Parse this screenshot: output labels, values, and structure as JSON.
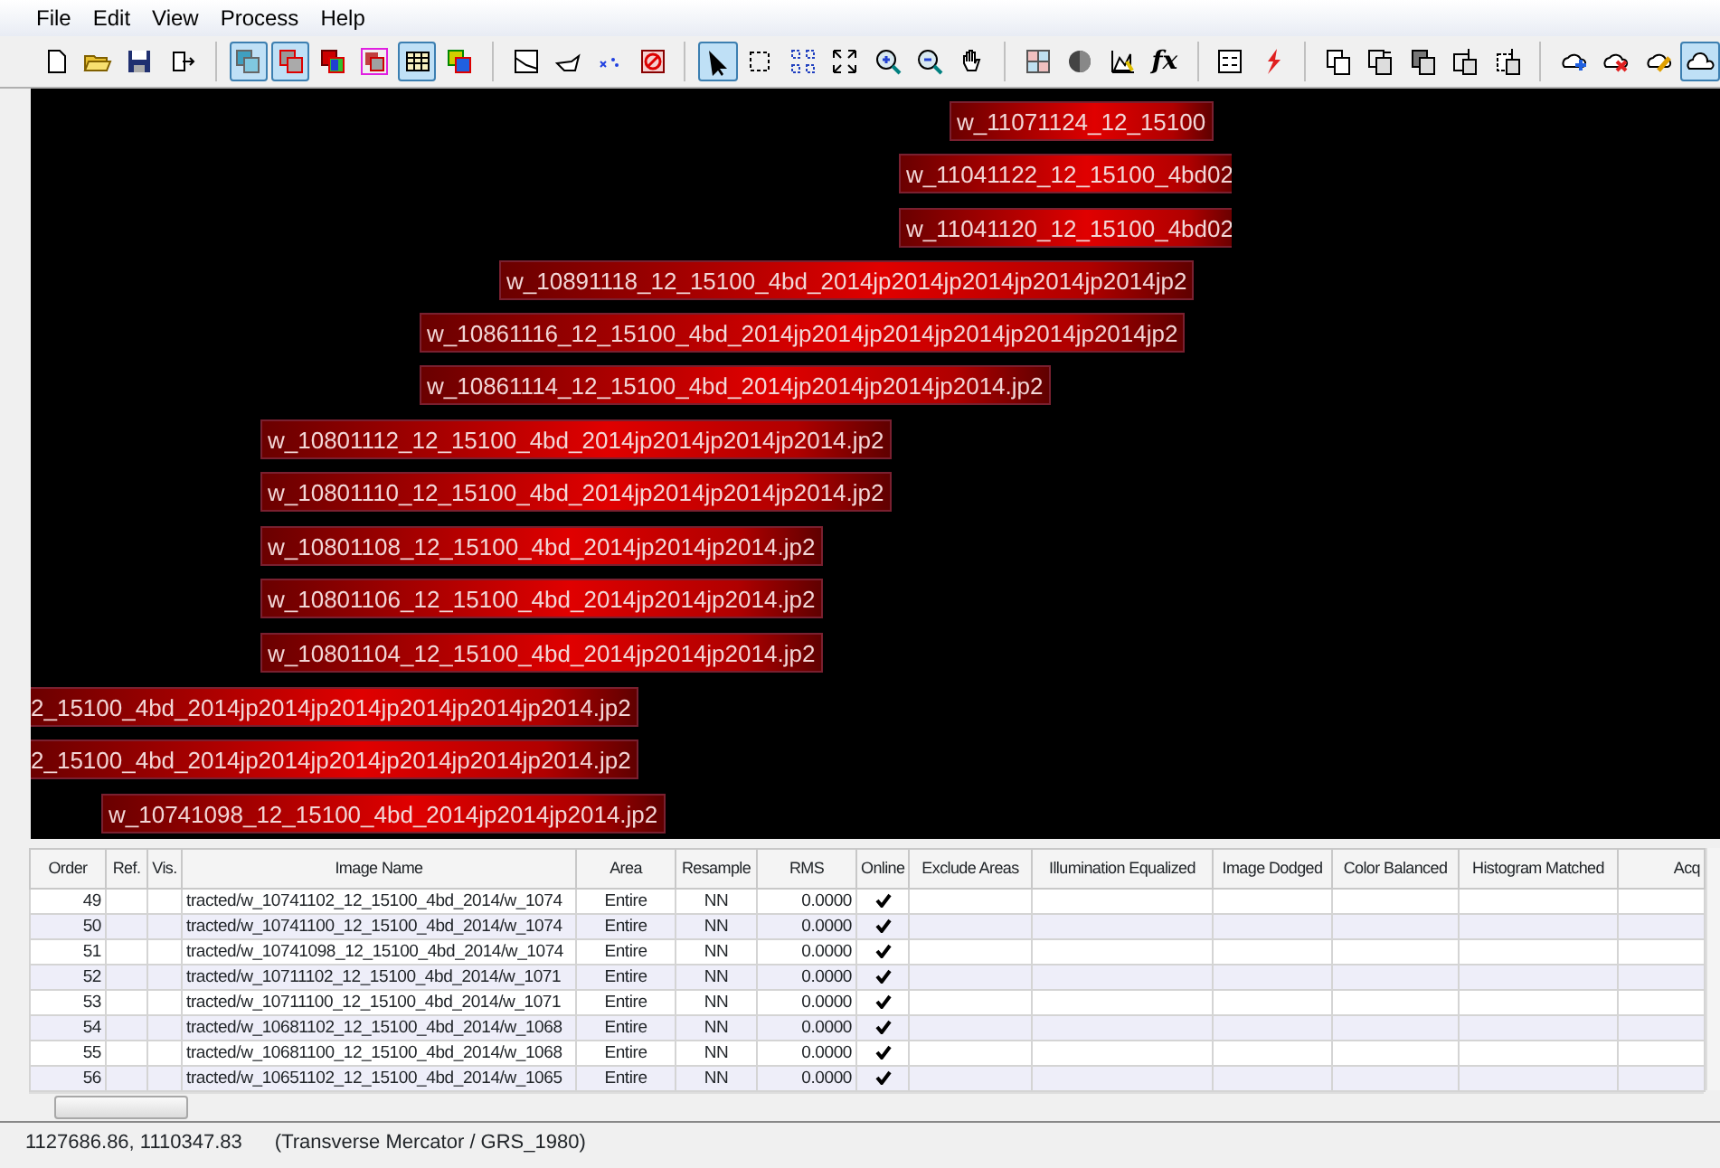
{
  "menu": [
    "File",
    "Edit",
    "View",
    "Process",
    "Help"
  ],
  "toolbar": [
    [
      {
        "kind": "new",
        "pressed": false
      },
      {
        "kind": "open",
        "pressed": false
      },
      {
        "kind": "save",
        "pressed": false
      },
      {
        "kind": "export",
        "pressed": false
      }
    ],
    [
      {
        "kind": "footprints",
        "pressed": true
      },
      {
        "kind": "boundaries",
        "pressed": true
      },
      {
        "kind": "color",
        "pressed": false
      },
      {
        "kind": "pink",
        "pressed": false
      },
      {
        "kind": "table",
        "pressed": true
      },
      {
        "kind": "balance",
        "pressed": false
      }
    ],
    [
      {
        "kind": "seamline",
        "pressed": false
      },
      {
        "kind": "edit",
        "pressed": false
      },
      {
        "kind": "points",
        "pressed": false
      },
      {
        "kind": "clear",
        "pressed": false
      }
    ],
    [
      {
        "kind": "select",
        "pressed": true
      },
      {
        "kind": "marquee",
        "pressed": false
      },
      {
        "kind": "fit",
        "pressed": false
      },
      {
        "kind": "full",
        "pressed": false
      },
      {
        "kind": "zoomin",
        "pressed": false
      },
      {
        "kind": "zoomout",
        "pressed": false
      },
      {
        "kind": "pan",
        "pressed": false
      }
    ],
    [
      {
        "kind": "tiles",
        "pressed": false
      },
      {
        "kind": "sphere",
        "pressed": false
      },
      {
        "kind": "chart",
        "pressed": false
      },
      {
        "kind": "text",
        "label": "fx",
        "pressed": false
      }
    ],
    [
      {
        "kind": "form",
        "pressed": false
      },
      {
        "kind": "bolt",
        "pressed": false
      }
    ],
    [
      {
        "kind": "copy",
        "pressed": false
      },
      {
        "kind": "copyarrow",
        "pressed": false
      },
      {
        "kind": "copydark",
        "pressed": false
      },
      {
        "kind": "copyup",
        "pressed": false
      },
      {
        "kind": "copydash",
        "pressed": false
      }
    ],
    [
      {
        "kind": "cloudadd",
        "pressed": false
      },
      {
        "kind": "clouddel",
        "pressed": false
      },
      {
        "kind": "cloudedit",
        "pressed": false
      },
      {
        "kind": "cloud",
        "pressed": true
      }
    ]
  ],
  "canvas_labels": [
    "w_11071124_12_15100",
    "w_11041122_12_15100_4bd02",
    "w_11041120_12_15100_4bd02",
    "w_10891118_12_15100_4bd_2014jp2014jp2014jp2014jp2014jp2",
    "w_10861116_12_15100_4bd_2014jp2014jp2014jp2014jp2014jp2014jp2",
    "w_10861114_12_15100_4bd_2014jp2014jp2014jp2014.jp2",
    "w_10801112_12_15100_4bd_2014jp2014jp2014jp2014.jp2",
    "w_10801110_12_15100_4bd_2014jp2014jp2014jp2014.jp2",
    "w_10801108_12_15100_4bd_2014jp2014jp2014.jp2",
    "w_10801106_12_15100_4bd_2014jp2014jp2014.jp2",
    "w_10801104_12_15100_4bd_2014jp2014jp2014.jp2",
    "2_15100_4bd_2014jp2014jp2014jp2014jp2014jp2014.jp2",
    "2_15100_4bd_2014jp2014jp2014jp2014jp2014jp2014.jp2",
    "w_10741098_12_15100_4bd_2014jp2014jp2014.jp2"
  ],
  "table": {
    "columns": [
      "Order",
      "Ref.",
      "Vis.",
      "Image Name",
      "Area",
      "Resample",
      "RMS",
      "Online",
      "Exclude Areas",
      "Illumination Equalized",
      "Image Dodged",
      "Color Balanced",
      "Histogram Matched",
      "Acq"
    ],
    "rows": [
      {
        "order": "49",
        "image_name": "tracted/w_10741102_12_15100_4bd_2014/w_1074",
        "area": "Entire",
        "resample": "NN",
        "rms": "0.0000",
        "online": true
      },
      {
        "order": "50",
        "image_name": "tracted/w_10741100_12_15100_4bd_2014/w_1074",
        "area": "Entire",
        "resample": "NN",
        "rms": "0.0000",
        "online": true
      },
      {
        "order": "51",
        "image_name": "tracted/w_10741098_12_15100_4bd_2014/w_1074",
        "area": "Entire",
        "resample": "NN",
        "rms": "0.0000",
        "online": true
      },
      {
        "order": "52",
        "image_name": "tracted/w_10711102_12_15100_4bd_2014/w_1071",
        "area": "Entire",
        "resample": "NN",
        "rms": "0.0000",
        "online": true
      },
      {
        "order": "53",
        "image_name": "tracted/w_10711100_12_15100_4bd_2014/w_1071",
        "area": "Entire",
        "resample": "NN",
        "rms": "0.0000",
        "online": true
      },
      {
        "order": "54",
        "image_name": "tracted/w_10681102_12_15100_4bd_2014/w_1068",
        "area": "Entire",
        "resample": "NN",
        "rms": "0.0000",
        "online": true
      },
      {
        "order": "55",
        "image_name": "tracted/w_10681100_12_15100_4bd_2014/w_1068",
        "area": "Entire",
        "resample": "NN",
        "rms": "0.0000",
        "online": true
      },
      {
        "order": "56",
        "image_name": "tracted/w_10651102_12_15100_4bd_2014/w_1065",
        "area": "Entire",
        "resample": "NN",
        "rms": "0.0000",
        "online": true
      }
    ]
  },
  "status_bar": {
    "coordinates": "1127686.86, 1110347.83",
    "projection": "(Transverse Mercator / GRS_1980)"
  }
}
